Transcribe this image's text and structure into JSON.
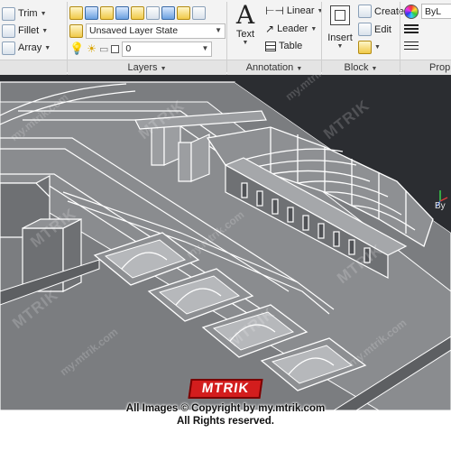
{
  "ribbon": {
    "modify": {
      "trim_label": "Trim",
      "fillet_label": "Fillet",
      "array_label": "Array"
    },
    "layers": {
      "layer_state": "Unsaved Layer State",
      "current_layer": "0",
      "panel_title": "Layers"
    },
    "annotation": {
      "text_label": "Text",
      "linear_label": "Linear",
      "leader_label": "Leader",
      "table_label": "Table",
      "panel_title": "Annotation"
    },
    "block": {
      "insert_label": "Insert",
      "create_label": "Create",
      "edit_label": "Edit",
      "panel_title": "Block"
    },
    "properties": {
      "bylayer_label": "ByL",
      "panel_title": "Prop"
    }
  },
  "viewcube": {
    "label": "By"
  },
  "watermark": {
    "brand": "MTRIK",
    "url": "my.mtrik.com"
  },
  "copyright": {
    "logo": "MTRIK",
    "line1": "All Images © Copyright by my.mtrik.com",
    "line2": "All Rights reserved."
  },
  "colors": {
    "viewport_bg": "#2b2d31",
    "model_fill": "#7d7f82",
    "model_edge": "#ffffff",
    "logo_red": "#d31d1d"
  }
}
